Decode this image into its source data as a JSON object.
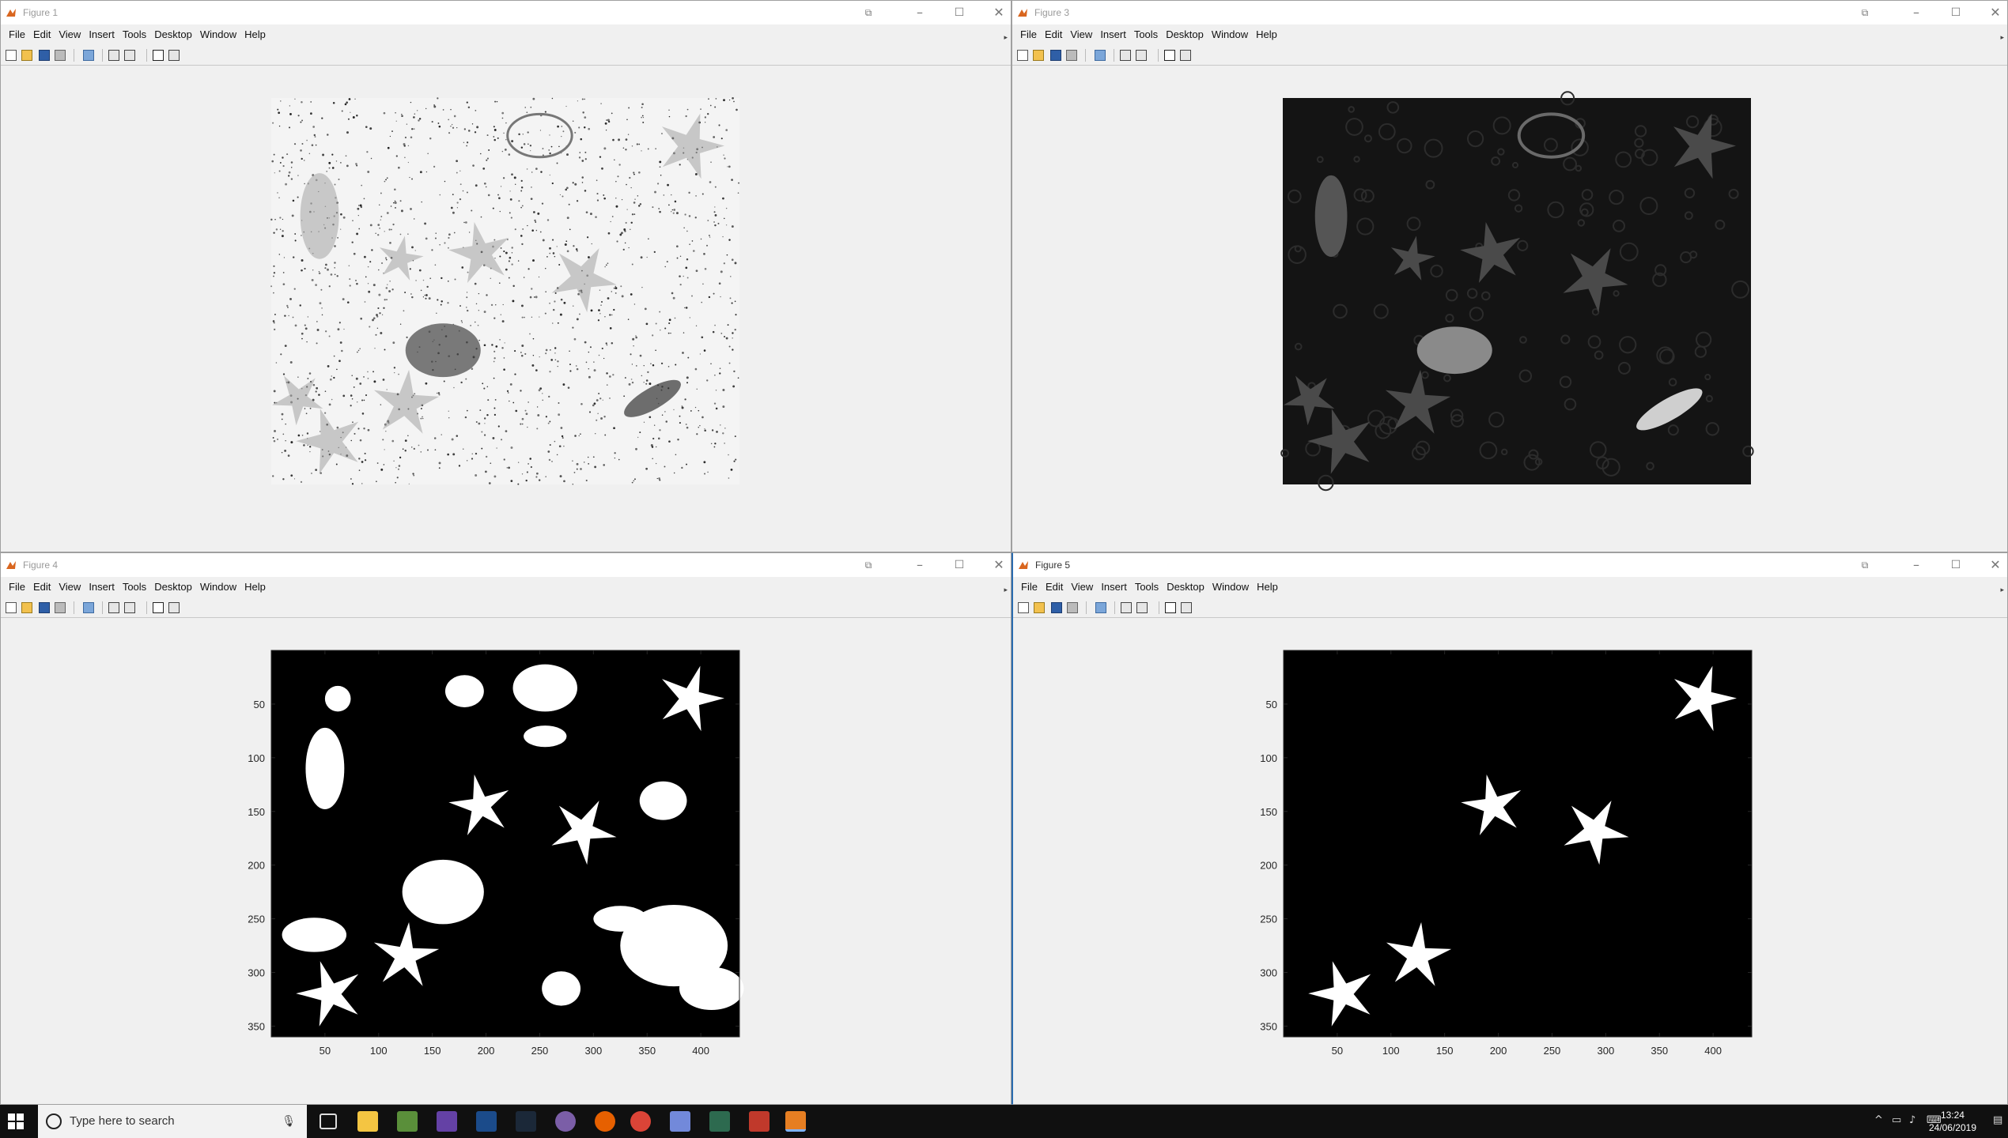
{
  "windows": [
    {
      "id": "w1",
      "title": "Figure 1",
      "kind": "noisy"
    },
    {
      "id": "w2",
      "title": "Figure 3",
      "kind": "dark"
    },
    {
      "id": "w3",
      "title": "Figure 4",
      "kind": "binary"
    },
    {
      "id": "w4",
      "title": "Figure 5",
      "kind": "stars"
    }
  ],
  "menu": [
    "File",
    "Edit",
    "View",
    "Insert",
    "Tools",
    "Desktop",
    "Window",
    "Help"
  ],
  "axes": {
    "xticks": [
      "50",
      "100",
      "150",
      "200",
      "250",
      "300",
      "350",
      "400"
    ],
    "yticks": [
      "50",
      "100",
      "150",
      "200",
      "250",
      "300",
      "350"
    ]
  },
  "taskbar": {
    "search_placeholder": "Type here to search",
    "time": "13:24",
    "date": "24/06/2019"
  },
  "colors": {
    "accent": "#2b6cb0",
    "taskbar": "#101010"
  }
}
